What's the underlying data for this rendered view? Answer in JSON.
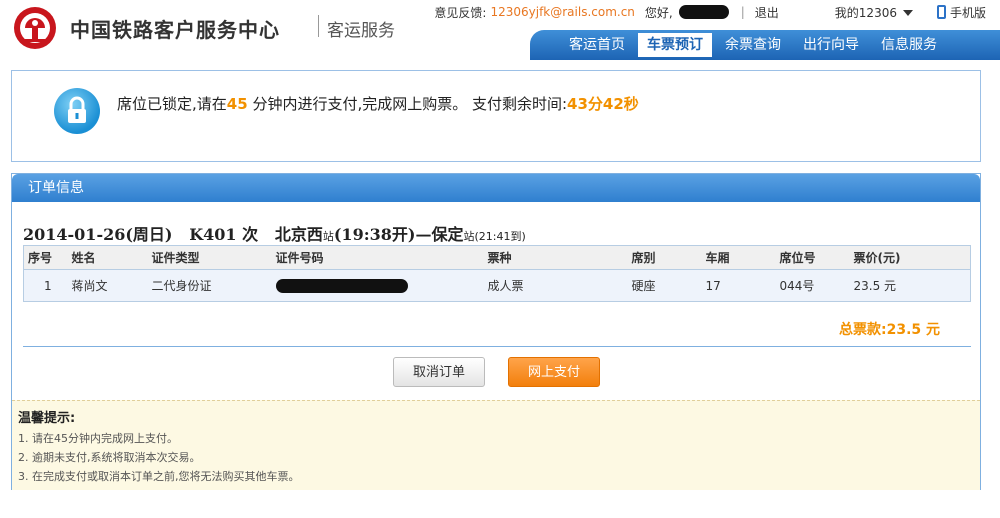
{
  "header": {
    "logo_title": "中国铁路客户服务中心",
    "logo_subtitle": "客运服务",
    "feedback_label": "意见反馈:",
    "feedback_email": "12306yjfk@rails.com.cn",
    "greeting": "您好,",
    "logout": "退出",
    "my_account": "我的12306",
    "mobile": "手机版"
  },
  "nav": {
    "items": [
      {
        "label": "客运首页"
      },
      {
        "label": "车票预订"
      },
      {
        "label": "余票查询"
      },
      {
        "label": "出行向导"
      },
      {
        "label": "信息服务"
      }
    ],
    "active_index": 1
  },
  "notice": {
    "text_a": "席位已锁定,请在",
    "minutes": "45",
    "text_b": "分钟内进行支付,完成网上购票。 支付剩余时间:",
    "remaining": "43分42秒"
  },
  "order": {
    "title": "订单信息",
    "trip": {
      "date": "2014-01-26(周日)",
      "train": "K401",
      "train_suffix": "次",
      "from": "北京西",
      "from_suffix": "站",
      "depart": "(19:38开)",
      "dash": "—",
      "to": "保定",
      "to_suffix": "站",
      "arrive": "(21:41到)"
    },
    "columns": [
      "序号",
      "姓名",
      "证件类型",
      "证件号码",
      "票种",
      "席别",
      "车厢",
      "席位号",
      "票价(元)"
    ],
    "rows": [
      {
        "no": "1",
        "name": "蒋尚文",
        "id_type": "二代身份证",
        "ticket_type": "成人票",
        "seat_class": "硬座",
        "car": "17",
        "seat": "044号",
        "price": "23.5 元"
      }
    ],
    "total": "总票款:23.5 元",
    "cancel_label": "取消订单",
    "pay_label": "网上支付"
  },
  "tips": {
    "title": "温馨提示:",
    "items": [
      "1.  请在45分钟内完成网上支付。",
      "2.  逾期未支付,系统将取消本次交易。",
      "3.  在完成支付或取消本订单之前,您将无法购买其他车票。"
    ]
  },
  "colors": {
    "accent_orange": "#f29100",
    "nav_blue": "#1d64b4",
    "panel_blue": "#2f7fcf",
    "logo_red": "#c8161d"
  }
}
